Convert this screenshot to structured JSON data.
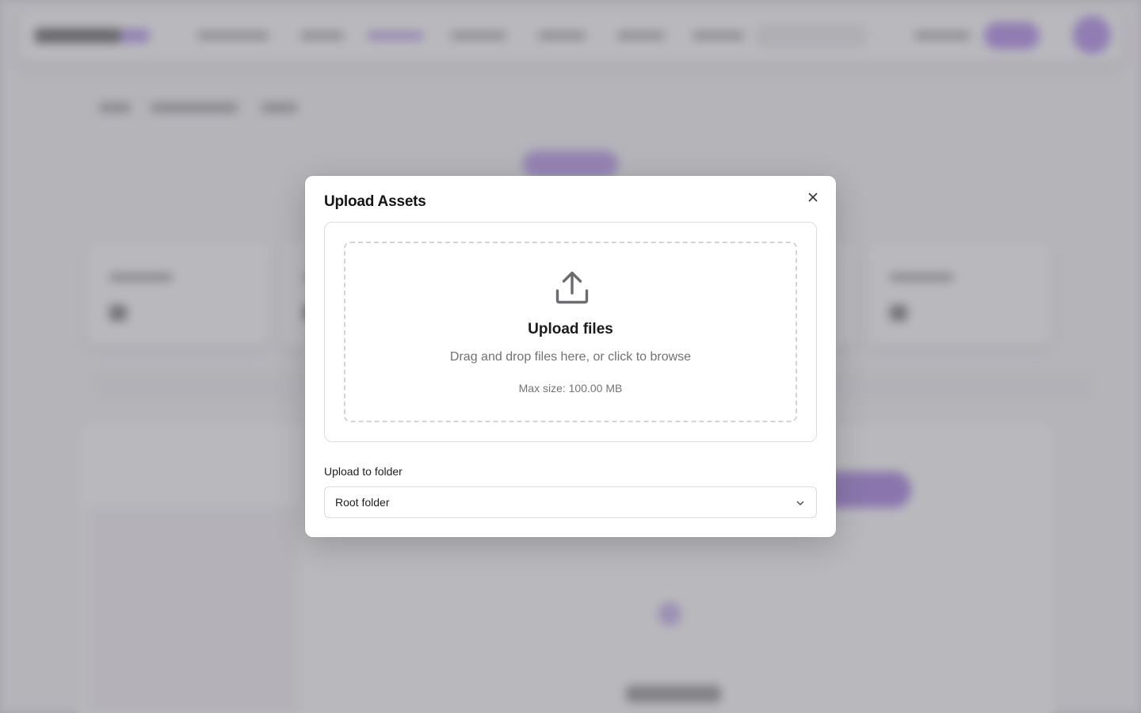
{
  "modal": {
    "title": "Upload Assets",
    "close_icon": "close-icon"
  },
  "dropzone": {
    "icon": "upload-icon",
    "title": "Upload files",
    "subtitle": "Drag and drop files here, or click to browse",
    "max_size": "Max size: 100.00 MB"
  },
  "folder": {
    "label": "Upload to folder",
    "selected": "Root folder",
    "chevron_icon": "chevron-down-icon"
  },
  "colors": {
    "accent": "#9b6be8",
    "overlay": "#46444e",
    "text_primary": "#141414",
    "text_muted": "#717171"
  }
}
